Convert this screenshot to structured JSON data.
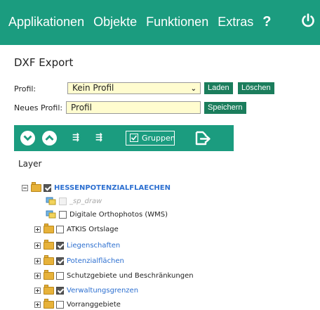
{
  "menu": {
    "items": [
      "Applikationen",
      "Objekte",
      "Funktionen",
      "Extras"
    ],
    "help_glyph": "?",
    "power_icon": "power-icon"
  },
  "page": {
    "title": "DXF Export"
  },
  "form": {
    "profile_label": "Profil:",
    "profile_value": "Kein Profil",
    "load_label": "Laden",
    "delete_label": "Löschen",
    "new_profile_label": "Neues Profil:",
    "new_profile_value": "Profil",
    "save_label": "Speichern"
  },
  "toolbar": {
    "expand_icon": "chevron-down-icon",
    "collapse_icon": "chevron-up-icon",
    "tree_expand_glyph": "⇶",
    "tree_collapse_glyph": "⇶",
    "groups_label": "Gruppen",
    "groups_checked": true,
    "export_icon": "export-icon"
  },
  "layer": {
    "heading": "Layer",
    "root": {
      "label": "HESSENPOTENZIALFLAECHEN",
      "checked": true
    },
    "children": [
      {
        "label": "_sp_draw",
        "type": "layer",
        "checked": false,
        "disabled": true
      },
      {
        "label": "Digitale Orthophotos (WMS)",
        "type": "layer",
        "checked": false
      },
      {
        "label": "ATKIS Ortslage",
        "type": "group",
        "checked": false
      },
      {
        "label": "Liegenschaften",
        "type": "group",
        "checked": true
      },
      {
        "label": "Potenzialflächen",
        "type": "group",
        "checked": true
      },
      {
        "label": "Schutzgebiete und Beschränkungen",
        "type": "group",
        "checked": false
      },
      {
        "label": "Verwaltungsgrenzen",
        "type": "group",
        "checked": true
      },
      {
        "label": "Vorranggebiete",
        "type": "group",
        "checked": false
      }
    ]
  },
  "colors": {
    "accent": "#1b9c7f",
    "button": "#1b7d5c",
    "input_bg": "#fffccf",
    "link": "#2c6fd0"
  }
}
